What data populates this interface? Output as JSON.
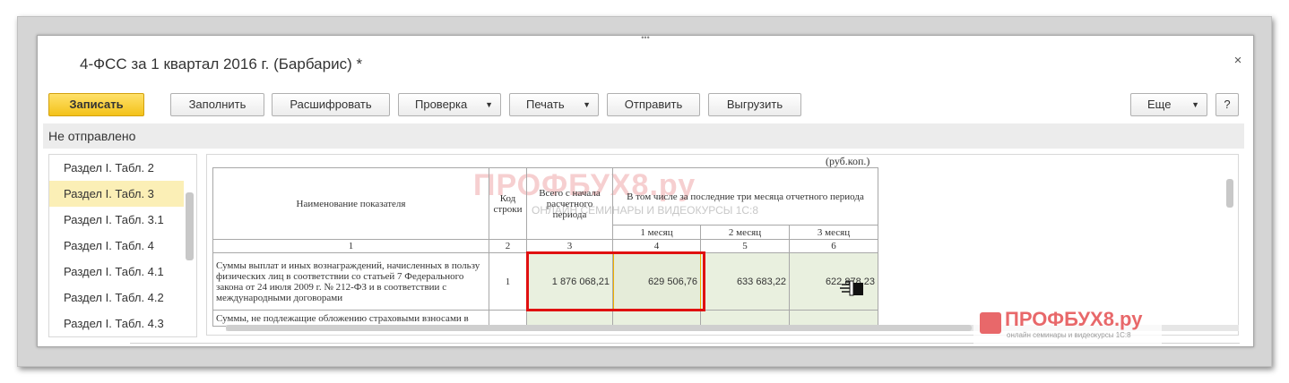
{
  "window": {
    "title": "4-ФСС за 1 квартал 2016 г. (Барбарис) *",
    "close_icon": "close-icon",
    "grip": "•••"
  },
  "toolbar": {
    "save_label": "Записать",
    "fill_label": "Заполнить",
    "decode_label": "Расшифровать",
    "check_label": "Проверка",
    "print_label": "Печать",
    "send_label": "Отправить",
    "export_label": "Выгрузить",
    "more_label": "Еще",
    "help_label": "?",
    "dropdown_arrow": "▼"
  },
  "status": {
    "text": "Не отправлено"
  },
  "sidebar": {
    "items": [
      {
        "label": "Раздел I. Табл. 2"
      },
      {
        "label": "Раздел I. Табл. 3"
      },
      {
        "label": "Раздел I. Табл. 3.1"
      },
      {
        "label": "Раздел I. Табл. 4"
      },
      {
        "label": "Раздел I. Табл. 4.1"
      },
      {
        "label": "Раздел I. Табл. 4.2"
      },
      {
        "label": "Раздел I. Табл. 4.3"
      }
    ],
    "active_index": 1
  },
  "report": {
    "units": "(руб.коп.)",
    "headers": {
      "name": "Наименование показателя",
      "code": "Код строки",
      "total": "Всего с начала расчетного периода",
      "last3": "В том числе за последние три месяца отчетного периода",
      "m1": "1 месяц",
      "m2": "2 месяц",
      "m3": "3 месяц"
    },
    "col_numbers": [
      "1",
      "2",
      "3",
      "4",
      "5",
      "6"
    ],
    "rows": [
      {
        "name": "Суммы выплат и иных вознаграждений, начисленных в пользу физических лиц в соответствии со статьей 7 Федерального закона от 24 июля 2009 г. № 212-ФЗ и в соответствии с международными договорами",
        "code": "1",
        "total": "1 876 068,21",
        "m1": "629 506,76",
        "m2": "633 683,22",
        "m3": "622 878,23"
      },
      {
        "name": "Суммы, не подлежащие обложению страховыми взносами в",
        "code": "",
        "total": "",
        "m1": "",
        "m2": "",
        "m3": ""
      }
    ]
  },
  "watermark": {
    "brand": "ПРОФБУХ8.ру",
    "tagline": "ОНЛАЙН СЕМИНАРЫ И ВИДЕОКУРСЫ 1С:8",
    "brand_small": "ПРОФБУХ8.ру",
    "tagline_small": "онлайн семинары и видеокурсы 1С:8"
  },
  "colors": {
    "accent_yellow": "#f3c21a",
    "highlight_red": "#e01010",
    "active_item": "#fbefb6",
    "cell_green": "#e9f0df"
  }
}
